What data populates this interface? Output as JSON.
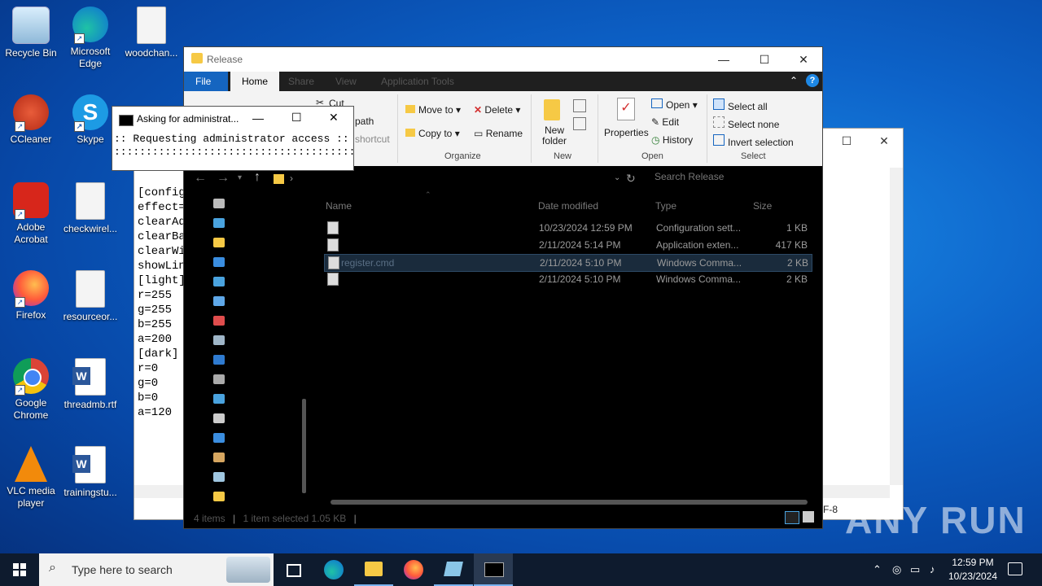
{
  "desktop": {
    "icons": [
      {
        "label": "Recycle Bin",
        "icon": "recycle-bin-icon"
      },
      {
        "label": "Microsoft Edge",
        "icon": "edge-icon"
      },
      {
        "label": "woodchan...",
        "icon": "image-file-icon"
      },
      {
        "label": "CCleaner",
        "icon": "ccleaner-icon"
      },
      {
        "label": "Skype",
        "icon": "skype-icon"
      },
      {
        "label": "Adobe Acrobat",
        "icon": "acrobat-icon"
      },
      {
        "label": "checkwirel...",
        "icon": "image-file-icon"
      },
      {
        "label": "Firefox",
        "icon": "firefox-icon"
      },
      {
        "label": "resourceor...",
        "icon": "image-file-icon"
      },
      {
        "label": "Google Chrome",
        "icon": "chrome-icon"
      },
      {
        "label": "threadmb.rtf",
        "icon": "word-doc-icon"
      },
      {
        "label": "VLC media player",
        "icon": "vlc-icon"
      },
      {
        "label": "trainingstu...",
        "icon": "word-doc-icon"
      }
    ]
  },
  "notepad": {
    "lines": [
      "[config",
      "effect=",
      "clearAd",
      "clearBa",
      "clearWi",
      "showLin",
      "[light]",
      "r=255",
      "g=255",
      "b=255",
      "a=200",
      "[dark]",
      "r=0",
      "g=0",
      "b=0",
      "a=120"
    ],
    "status_fragment": "F-8"
  },
  "cmd_window": {
    "title": "Asking for administrat...",
    "line1": ":: Requesting administrator access ::",
    "line2": "::::::::::::::::::::::::::::::::::::::"
  },
  "explorer": {
    "title": "Release",
    "tabs": {
      "file": "File",
      "home": "Home",
      "share": "Share",
      "view": "View",
      "app_tools": "Application Tools"
    },
    "ribbon": {
      "cut": "Cut",
      "copy_path": "path",
      "paste_shortcut": "shortcut",
      "move_to": "Move to",
      "copy_to": "Copy to",
      "delete": "Delete",
      "rename": "Rename",
      "organize": "Organize",
      "new_folder_1": "New",
      "new_folder_2": "folder",
      "new_group": "New",
      "properties": "Properties",
      "open": "Open",
      "edit": "Edit",
      "history": "History",
      "open_group": "Open",
      "select_all": "Select all",
      "select_none": "Select none",
      "invert_selection": "Invert selection",
      "select_group": "Select"
    },
    "search_placeholder": "Search Release",
    "columns": {
      "name": "Name",
      "date": "Date modified",
      "type": "Type",
      "size": "Size"
    },
    "files": [
      {
        "name": "",
        "date": "10/23/2024 12:59 PM",
        "type": "Configuration sett...",
        "size": "1 KB",
        "selected": false
      },
      {
        "name": "",
        "date": "2/11/2024 5:14 PM",
        "type": "Application exten...",
        "size": "417 KB",
        "selected": false
      },
      {
        "name": "register.cmd",
        "date": "2/11/2024 5:10 PM",
        "type": "Windows Comma...",
        "size": "2 KB",
        "selected": true
      },
      {
        "name": "",
        "date": "2/11/2024 5:10 PM",
        "type": "Windows Comma...",
        "size": "2 KB",
        "selected": false
      }
    ],
    "status": {
      "items": "4 items",
      "selected": "1 item selected  1.05 KB"
    }
  },
  "taskbar": {
    "search_placeholder": "Type here to search",
    "time": "12:59 PM",
    "date": "10/23/2024"
  },
  "watermark": "ANY RUN"
}
